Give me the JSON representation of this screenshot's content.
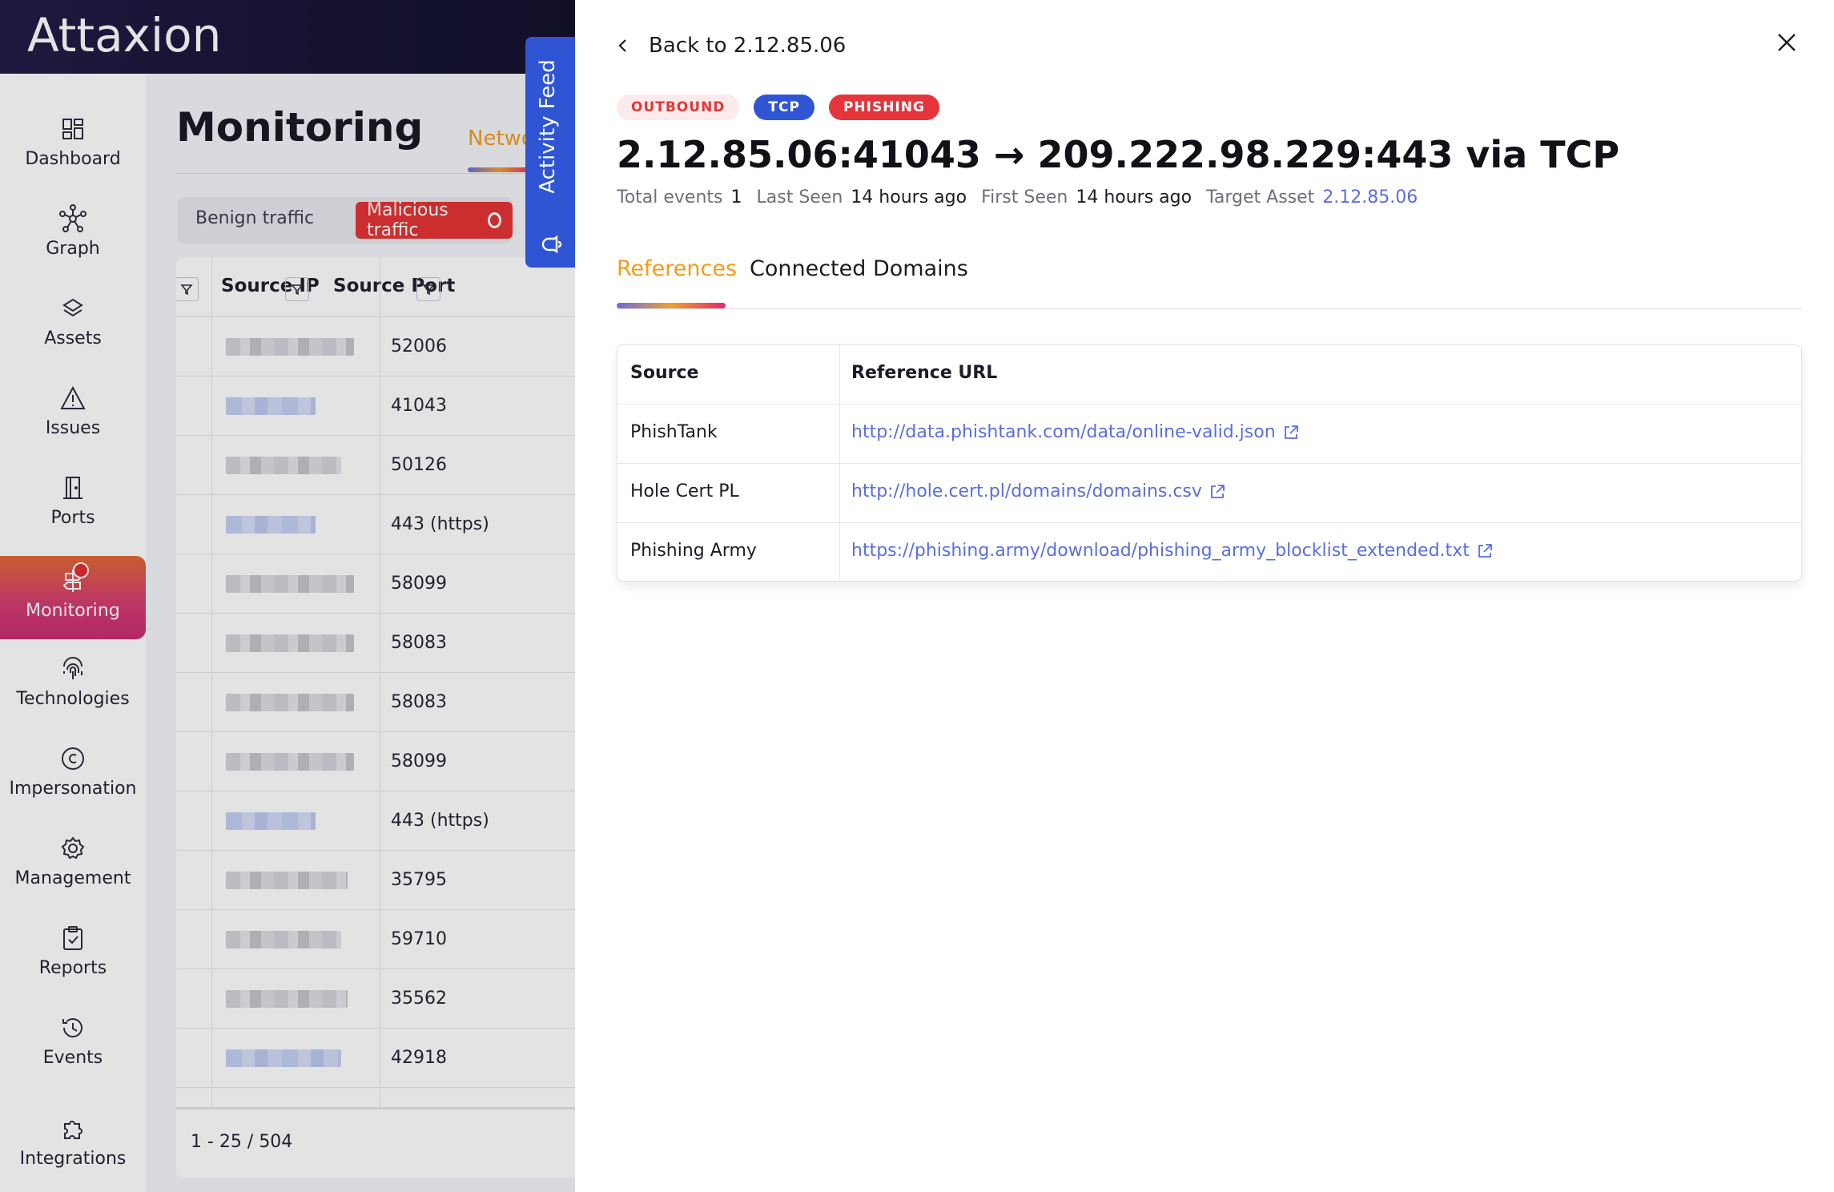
{
  "app": {
    "logo_text": "Attaxion"
  },
  "sidebar": {
    "items": [
      {
        "label": "Dashboard",
        "icon": "dashboard-icon"
      },
      {
        "label": "Graph",
        "icon": "graph-icon"
      },
      {
        "label": "Assets",
        "icon": "layers-icon"
      },
      {
        "label": "Issues",
        "icon": "warning-icon"
      },
      {
        "label": "Ports",
        "icon": "door-icon"
      },
      {
        "label": "Monitoring",
        "icon": "signpost-icon",
        "active": true
      },
      {
        "label": "Technologies",
        "icon": "fingerprint-icon"
      },
      {
        "label": "Impersonation",
        "icon": "copyright-icon"
      },
      {
        "label": "Management",
        "icon": "gear-icon"
      },
      {
        "label": "Reports",
        "icon": "clipboard-icon"
      },
      {
        "label": "Events",
        "icon": "history-icon"
      },
      {
        "label": "Integrations",
        "icon": "puzzle-icon"
      }
    ]
  },
  "main": {
    "title": "Monitoring",
    "tab_partial": "Netwo",
    "toggle": {
      "benign": "Benign traffic",
      "malicious": "Malicious traffic"
    },
    "table": {
      "headers": {
        "source_ip": "Source IP",
        "source_port": "Source Port"
      },
      "ports": [
        "52006",
        "41043",
        "50126",
        "443 (https)",
        "58099",
        "58083",
        "58083",
        "58099",
        "443 (https)",
        "35795",
        "59710",
        "35562",
        "42918"
      ],
      "pagination": "1 - 25 / 504"
    }
  },
  "activity_feed": {
    "label": "Activity Feed"
  },
  "drawer": {
    "back_label": "Back to 2.12.85.06",
    "badges": [
      "OUTBOUND",
      "TCP",
      "PHISHING"
    ],
    "title": "2.12.85.06:41043 → 209.222.98.229:443 via TCP",
    "meta": {
      "total_events_label": "Total events",
      "total_events": "1",
      "last_seen_label": "Last Seen",
      "last_seen": "14 hours ago",
      "first_seen_label": "First Seen",
      "first_seen": "14 hours ago",
      "target_asset_label": "Target Asset",
      "target_asset": "2.12.85.06"
    },
    "tabs": [
      "References",
      "Connected Domains"
    ],
    "references": {
      "headers": {
        "source": "Source",
        "url": "Reference URL"
      },
      "rows": [
        {
          "source": "PhishTank",
          "url": "http://data.phishtank.com/data/online-valid.json"
        },
        {
          "source": "Hole Cert PL",
          "url": "http://hole.cert.pl/domains/domains.csv"
        },
        {
          "source": "Phishing Army",
          "url": "https://phishing.army/download/phishing_army_blocklist_extended.txt"
        }
      ]
    }
  },
  "colors": {
    "accent_orange": "#f19b1c",
    "link_blue": "#5a6fdc",
    "tcp_blue": "#2f55d4",
    "phishing_red": "#e5353a"
  }
}
